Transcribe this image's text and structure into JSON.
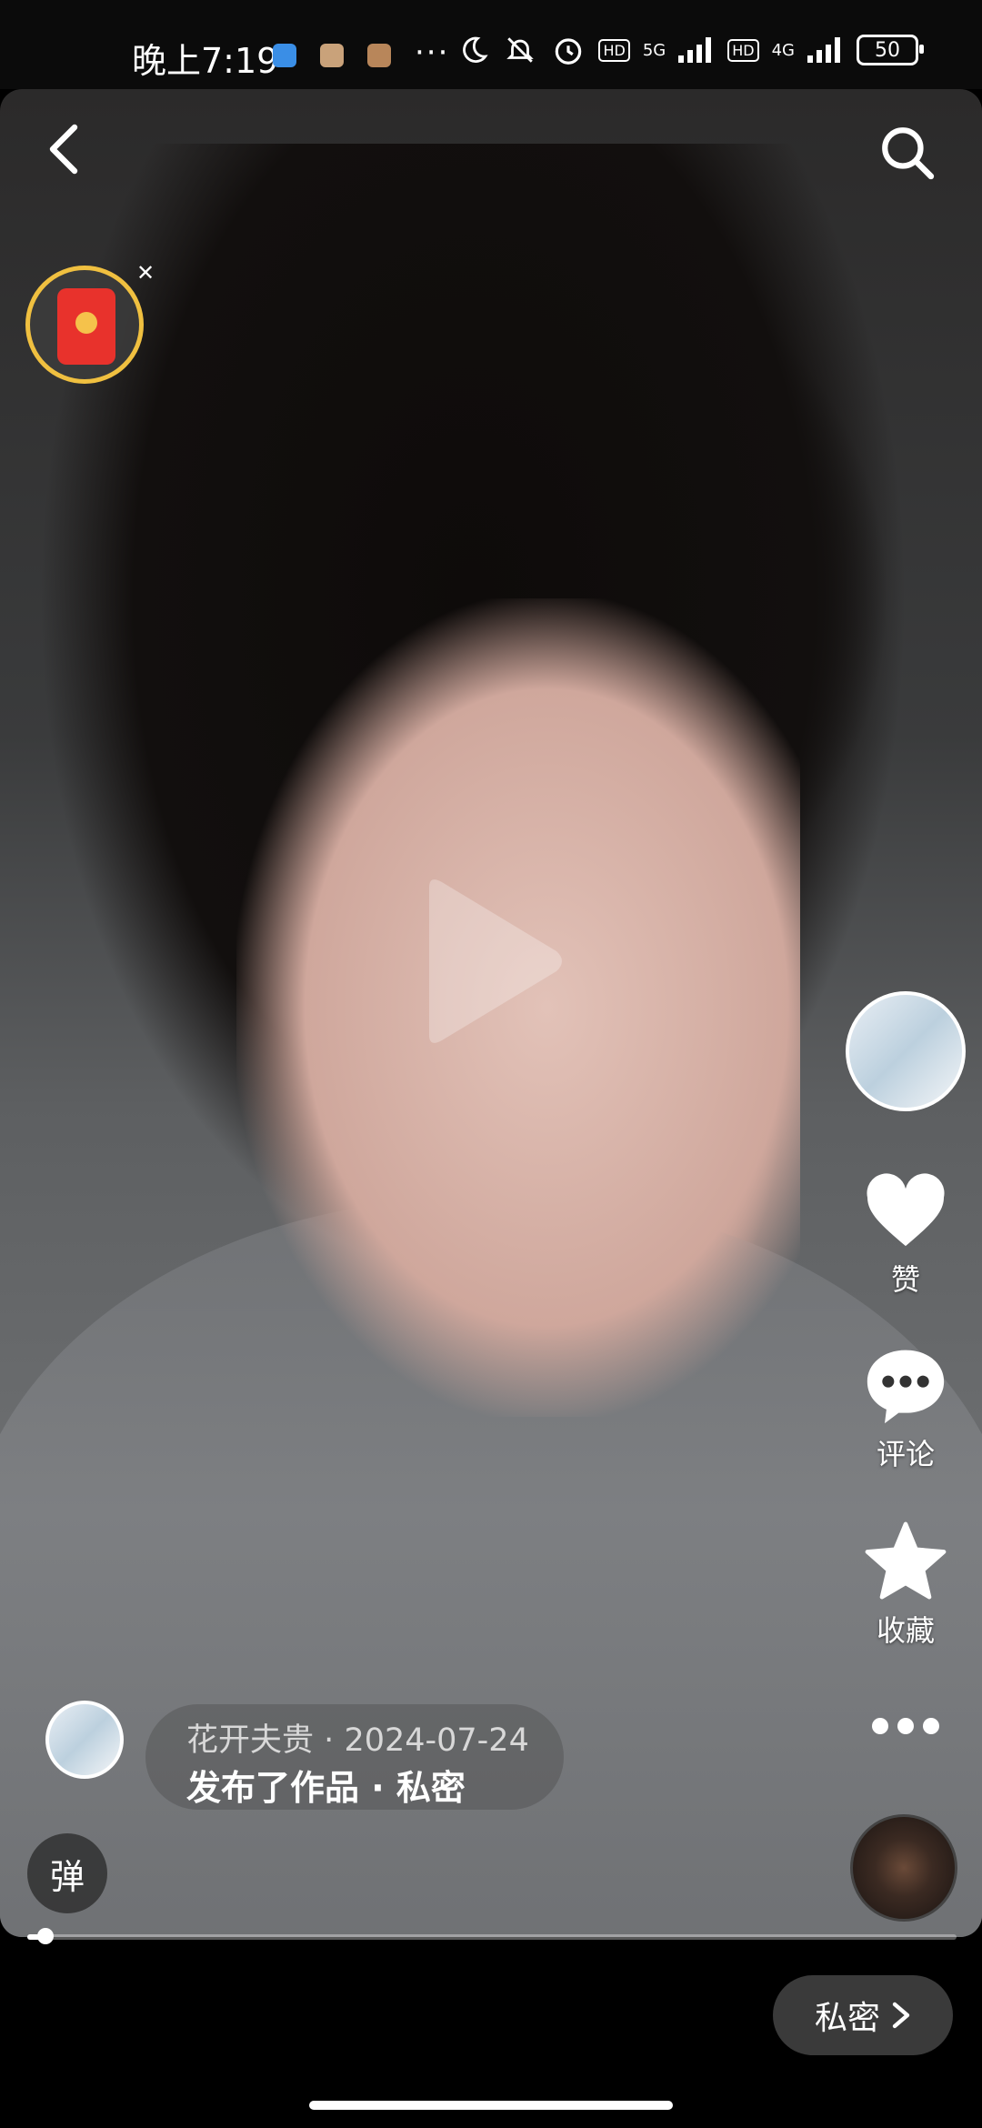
{
  "status_bar": {
    "time": "晚上7:19",
    "more": "···",
    "network_1": "5G",
    "network_2": "4G",
    "battery": "50"
  },
  "player": {
    "progress_fraction": 0.02
  },
  "side_actions": {
    "like_label": "赞",
    "comment_label": "评论",
    "favorite_label": "收藏"
  },
  "post_info": {
    "author": "花开夫贵",
    "date": "2024-07-24",
    "separator": "·",
    "action": "发布了作品",
    "visibility": "私密"
  },
  "controls": {
    "danmu_label": "弹",
    "private_button_label": "私密"
  },
  "colors": {
    "accent_red": "#e8322c",
    "ring_gold": "#f0c040"
  }
}
